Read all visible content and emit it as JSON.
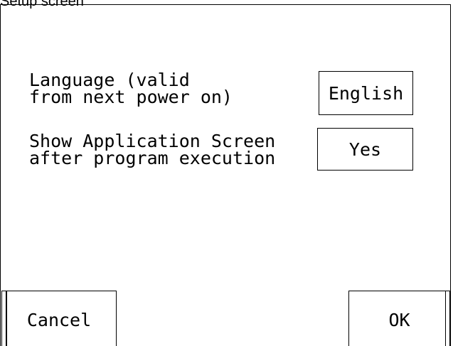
{
  "window": {
    "title": "Setup screen"
  },
  "settings": {
    "language": {
      "label_line1": "Language (valid",
      "label_line2": "from next power on)",
      "value": "English"
    },
    "show_application_screen": {
      "label_line1": "Show Application Screen",
      "label_line2": "after program execution",
      "value": "Yes"
    }
  },
  "buttons": {
    "cancel": "Cancel",
    "ok": "OK"
  }
}
